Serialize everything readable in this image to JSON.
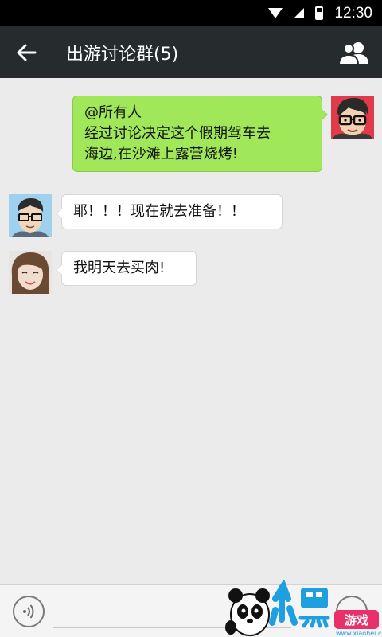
{
  "status_bar": {
    "time": "12:30"
  },
  "header": {
    "title": "出游讨论群(5)"
  },
  "messages": [
    {
      "direction": "out",
      "lines": [
        "@所有人",
        "经过讨论决定这个假期驾车去",
        "海边,在沙滩上露营烧烤!"
      ]
    },
    {
      "direction": "in",
      "lines": [
        "耶！！！现在就去准备！！"
      ]
    },
    {
      "direction": "in",
      "lines": [
        "我明天去买肉!"
      ]
    }
  ],
  "input": {
    "placeholder": ""
  },
  "watermark": {
    "brand": "小黑游戏",
    "url": "www.xiaohei.com"
  },
  "colors": {
    "title_bar": "#262b2e",
    "chat_bg": "#ebebeb",
    "bubble_out": "#a0e75a",
    "bubble_in": "#ffffff"
  }
}
